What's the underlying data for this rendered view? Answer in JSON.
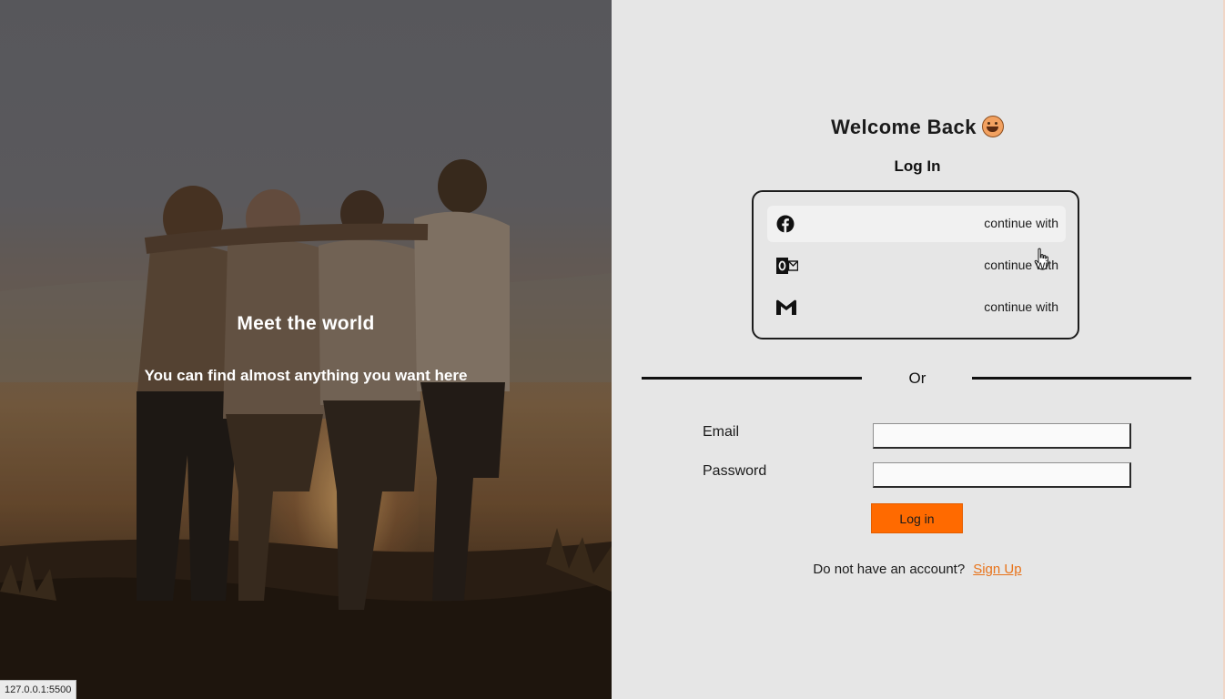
{
  "hero": {
    "title": "Meet the world",
    "subtitle": "You can find almost anything you want here"
  },
  "status_bar": {
    "url": "127.0.0.1:5500"
  },
  "login": {
    "welcome": "Welcome Back",
    "welcome_emoji": "grinning-face-emoji",
    "title": "Log In",
    "providers": [
      {
        "icon": "facebook-icon",
        "label": "continue with"
      },
      {
        "icon": "outlook-icon",
        "label": "continue with"
      },
      {
        "icon": "gmail-icon",
        "label": "continue with"
      }
    ],
    "divider_text": "Or",
    "email_label": "Email",
    "email_value": "",
    "password_label": "Password",
    "password_value": "",
    "submit_label": "Log in",
    "signup_prompt": "Do not have an account?",
    "signup_link": "Sign Up"
  },
  "colors": {
    "accent": "#ff6a00",
    "link": "#e8731a",
    "panel_bg": "#e6e6e6"
  }
}
